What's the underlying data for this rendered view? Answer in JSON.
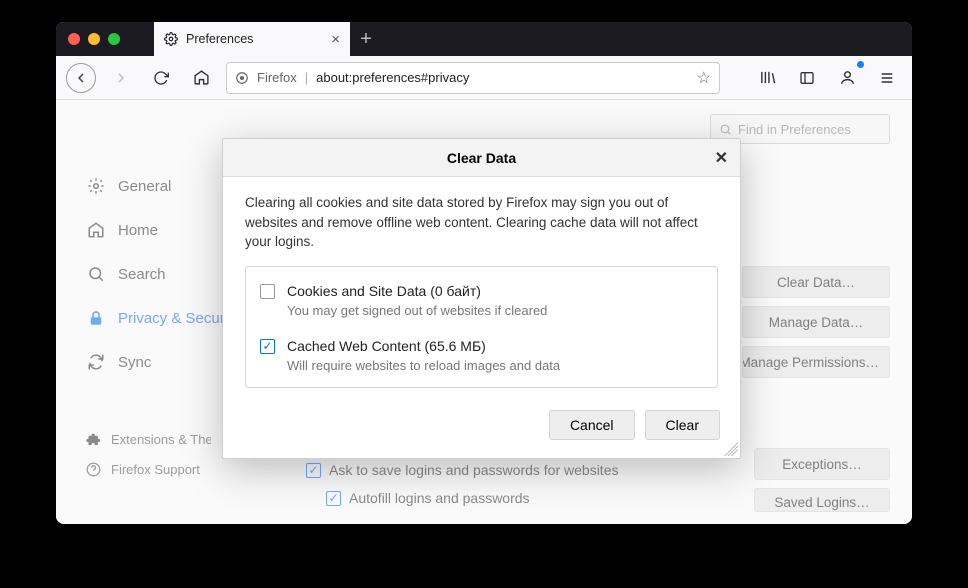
{
  "tab": {
    "title": "Preferences"
  },
  "url": {
    "label": "Firefox",
    "addr": "about:preferences#privacy"
  },
  "searchbox": {
    "placeholder": "Find in Preferences"
  },
  "sidebar": {
    "items": [
      {
        "label": "General"
      },
      {
        "label": "Home"
      },
      {
        "label": "Search"
      },
      {
        "label": "Privacy & Security"
      },
      {
        "label": "Sync"
      }
    ],
    "footer": [
      {
        "label": "Extensions & Themes"
      },
      {
        "label": "Firefox Support"
      }
    ]
  },
  "right_buttons": [
    "Clear Data…",
    "Manage Data…",
    "Manage Permissions…"
  ],
  "bottom_checks": [
    "Ask to save logins and passwords for websites",
    "Autofill logins and passwords"
  ],
  "right_buttons2": [
    "Exceptions…",
    "Saved Logins…"
  ],
  "dialog": {
    "title": "Clear Data",
    "desc": "Clearing all cookies and site data stored by Firefox may sign you out of websites and remove offline web content. Clearing cache data will not affect your logins.",
    "options": [
      {
        "label": "Cookies and Site Data (0 байт)",
        "sub": "You may get signed out of websites if cleared",
        "checked": false
      },
      {
        "label": "Cached Web Content (65.6 МБ)",
        "sub": "Will require websites to reload images and data",
        "checked": true
      }
    ],
    "cancel": "Cancel",
    "clear": "Clear"
  }
}
